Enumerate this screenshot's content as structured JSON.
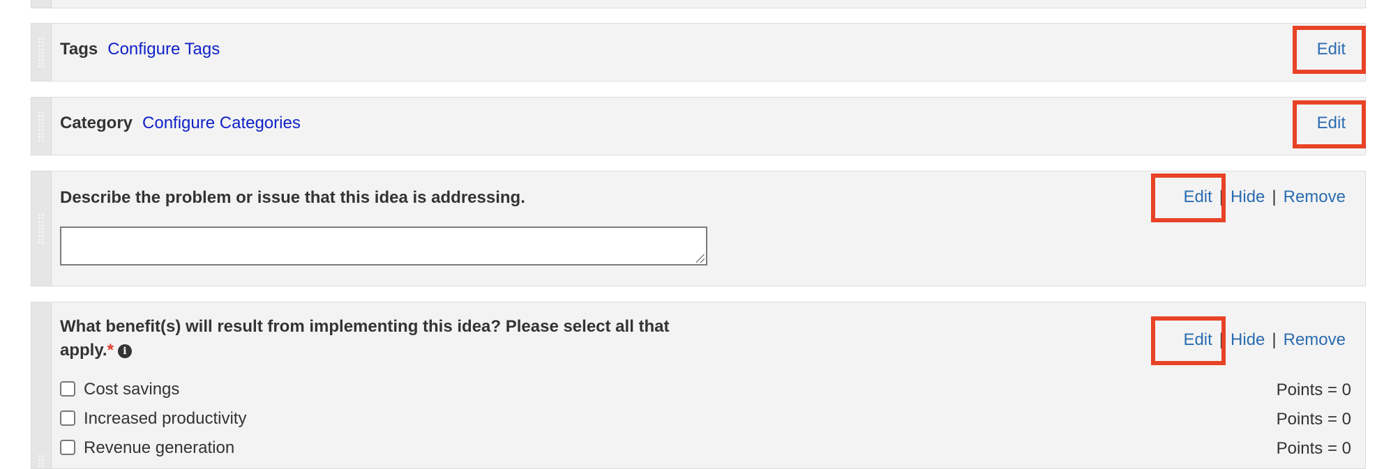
{
  "fields": {
    "tags": {
      "label": "Tags",
      "link": "Configure Tags",
      "edit": "Edit"
    },
    "category": {
      "label": "Category",
      "link": "Configure Categories",
      "edit": "Edit"
    },
    "problem": {
      "label": "Describe the problem or issue that this idea is addressing.",
      "textarea_value": "",
      "edit": "Edit",
      "hide": "Hide",
      "remove": "Remove",
      "separator": "|"
    },
    "benefits": {
      "label_line1": "What benefit(s) will result from implementing this idea? Please select all that",
      "label_line2": "apply.",
      "required_mark": "*",
      "info_icon": "info-circle-icon",
      "edit": "Edit",
      "hide": "Hide",
      "remove": "Remove",
      "separator": "|",
      "options": [
        {
          "label": "Cost savings",
          "checked": false,
          "points": "Points = 0"
        },
        {
          "label": "Increased productivity",
          "checked": false,
          "points": "Points = 0"
        },
        {
          "label": "Revenue generation",
          "checked": false,
          "points": "Points = 0"
        }
      ]
    }
  },
  "colors": {
    "highlight": "#e84326",
    "link": "#1022c8",
    "action": "#2a6cb0",
    "required": "#e03a2a"
  }
}
